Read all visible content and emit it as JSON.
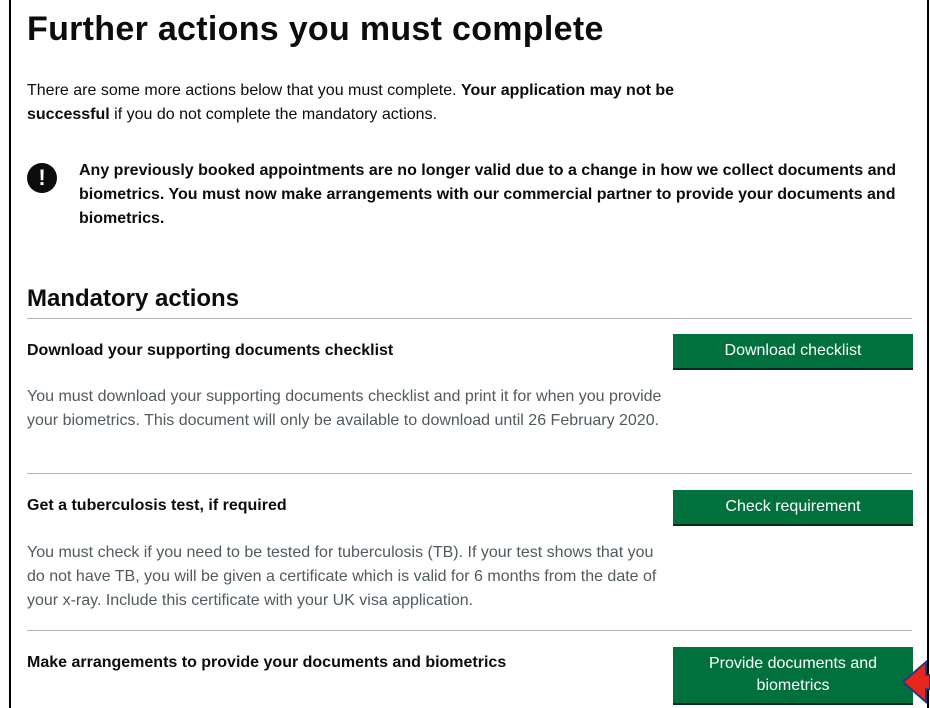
{
  "page": {
    "title": "Further actions you must complete",
    "intro_part1": "There are some more actions below that you must complete. ",
    "intro_bold": "Your application may not be successful",
    "intro_part2": " if you do not complete the mandatory actions."
  },
  "warning": {
    "icon": "exclamation-icon",
    "icon_glyph": "!",
    "text": "Any previously booked appointments are no longer valid due to a change in how we collect documents and biometrics. You must now make arrangements with our commercial partner to provide your documents and biometrics."
  },
  "mandatory": {
    "heading": "Mandatory actions",
    "actions": [
      {
        "title": "Download your supporting documents checklist",
        "description": "You must download your supporting documents checklist and print it for when you provide your biometrics. This document will only be available to download until 26 February 2020.",
        "button_label": "Download checklist"
      },
      {
        "title": "Get a tuberculosis test, if required",
        "description": "You must check if you need to be tested for tuberculosis (TB). If your test shows that you do not have TB, you will be given a certificate which is valid for 6 months from the date of your x-ray. Include this certificate with your UK visa application.",
        "button_label": "Check requirement"
      },
      {
        "title": "Make arrangements to provide your documents and biometrics",
        "button_label": "Provide documents and biometrics"
      }
    ]
  },
  "colors": {
    "button_green": "#00703c",
    "arrow_red": "#e8261c",
    "arrow_outline": "#1f3d7a"
  }
}
